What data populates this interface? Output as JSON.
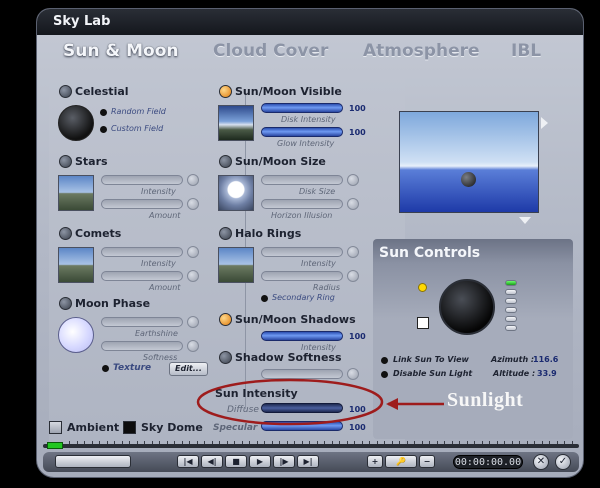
{
  "window": {
    "title": "Sky Lab"
  },
  "tabs": [
    "Sun & Moon",
    "Cloud Cover",
    "Atmosphere",
    "IBL"
  ],
  "left_column": {
    "celestial": {
      "label": "Celestial",
      "options": [
        "Random Field",
        "Custom Field"
      ]
    },
    "stars": {
      "label": "Stars",
      "sliders": [
        "Intensity",
        "Amount"
      ]
    },
    "comets": {
      "label": "Comets",
      "sliders": [
        "Intensity",
        "Amount"
      ]
    },
    "moon_phase": {
      "label": "Moon Phase",
      "sliders": [
        "Earthshine",
        "Softness"
      ],
      "texture_label": "Texture",
      "edit_button": "Edit..."
    }
  },
  "middle_column": {
    "sun_moon_visible": {
      "label": "Sun/Moon Visible",
      "sliders": [
        {
          "label": "Disk Intensity",
          "value": "100"
        },
        {
          "label": "Glow Intensity",
          "value": "100"
        }
      ]
    },
    "sun_moon_size": {
      "label": "Sun/Moon Size",
      "sliders": [
        "Disk Size",
        "Horizon Illusion"
      ]
    },
    "halo_rings": {
      "label": "Halo Rings",
      "sliders": [
        "Intensity",
        "Radius"
      ],
      "option": "Secondary Ring"
    },
    "sun_moon_shadows": {
      "label": "Sun/Moon Shadows",
      "sliders": [
        {
          "label": "Intensity",
          "value": "100"
        }
      ]
    },
    "shadow_softness": {
      "label": "Shadow Softness"
    },
    "sun_intensity": {
      "label": "Sun Intensity",
      "diffuse_label": "Diffuse",
      "diffuse_value": "100",
      "specular_label": "Specular",
      "specular_value": "100"
    }
  },
  "sun_controls": {
    "title": "Sun Controls",
    "link_option": "Link Sun To View",
    "disable_option": "Disable Sun Light",
    "azimuth_label": "Azimuth :",
    "azimuth_value": "116.6",
    "altitude_label": "Altitude :",
    "altitude_value": "33.9",
    "sun_color": "#ffd800"
  },
  "bottom_checks": {
    "ambient": "Ambient",
    "sky_dome": "Sky Dome"
  },
  "transport": {
    "time": "00:00:00.00",
    "playback_buttons": [
      "|◀",
      "◀|",
      "■",
      "▶",
      "|▶",
      "▶|"
    ],
    "keyframe_buttons": [
      "+",
      "−"
    ]
  },
  "annotation": {
    "text": "Sunlight",
    "color": "#9e1c1c"
  }
}
